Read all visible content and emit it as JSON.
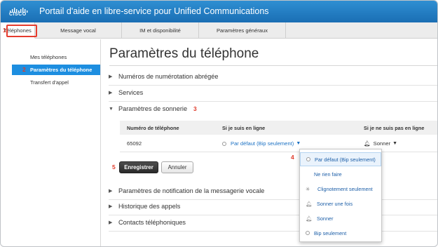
{
  "header": {
    "logo_text": "CISCO",
    "title": "Portail d'aide en libre-service pour Unified Communications"
  },
  "tabs": [
    "Téléphones",
    "Message vocal",
    "IM et disponibilité",
    "Paramètres généraux"
  ],
  "markers": [
    "1",
    "2",
    "3",
    "4",
    "5"
  ],
  "sidebar": {
    "items": [
      "Mes téléphones",
      "Paramètres du téléphone",
      "Transfert d'appel"
    ]
  },
  "main": {
    "page_title": "Paramètres du téléphone",
    "sections": [
      "Numéros de numérotation abrégée",
      "Services",
      "Paramètres de sonnerie",
      "Paramètres de notification de la messagerie vocale",
      "Historique des appels",
      "Contacts téléphoniques"
    ],
    "table": {
      "headers": [
        "Numéro de téléphone",
        "Si je suis en ligne",
        "Si je ne suis pas en ligne"
      ],
      "row": {
        "number": "65092",
        "online": "Par défaut (Bip seulement)",
        "offline": "Sonner"
      }
    },
    "buttons": {
      "save": "Enregistrer",
      "cancel": "Annuler"
    }
  },
  "dropdown": {
    "options": [
      "Par défaut (Bip seulement)",
      "Ne rien faire",
      "Clignotement seulement",
      "Sonner une fois",
      "Sonner",
      "Bip seulement"
    ],
    "selected": "Par défaut (Bip seulement)"
  },
  "colors": {
    "header": "#1a6eb4",
    "accent": "#1d8ee0",
    "marker": "#e03a2a",
    "link": "#1d72c4"
  }
}
